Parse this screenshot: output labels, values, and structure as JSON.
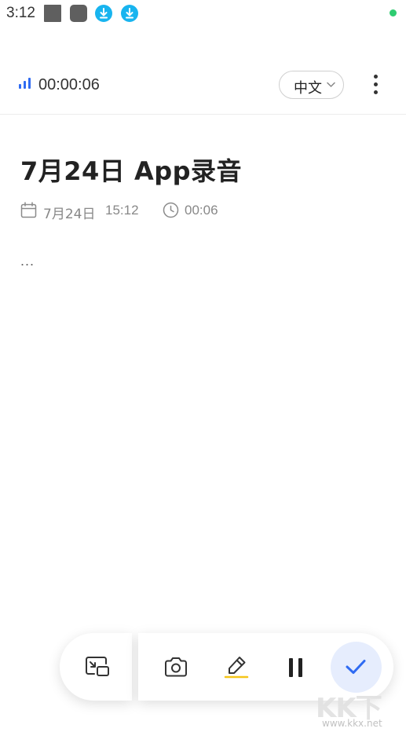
{
  "status_bar": {
    "time": "3:12",
    "icons": [
      "gallery-icon",
      "app-icon",
      "download-icon",
      "download-icon"
    ],
    "indicator_color": "#2ecc71"
  },
  "recording": {
    "elapsed": "00:00:06",
    "indicator_color": "#2f6bf2"
  },
  "language": {
    "selected": "中文"
  },
  "note": {
    "title": "7月24日 App录音",
    "date": "7月24日",
    "time": "15:12",
    "duration": "00:06",
    "transcript": "..."
  },
  "toolbar": {
    "tools": [
      "picture-in-picture-icon",
      "camera-icon",
      "highlighter-icon",
      "pause-icon",
      "check-icon"
    ],
    "accent_color": "#2f6bf2",
    "done_bg": "#e6edfd",
    "highlight_color": "#f5c518"
  },
  "watermark": {
    "text": "KK下载",
    "url": "www.kkx.net"
  }
}
